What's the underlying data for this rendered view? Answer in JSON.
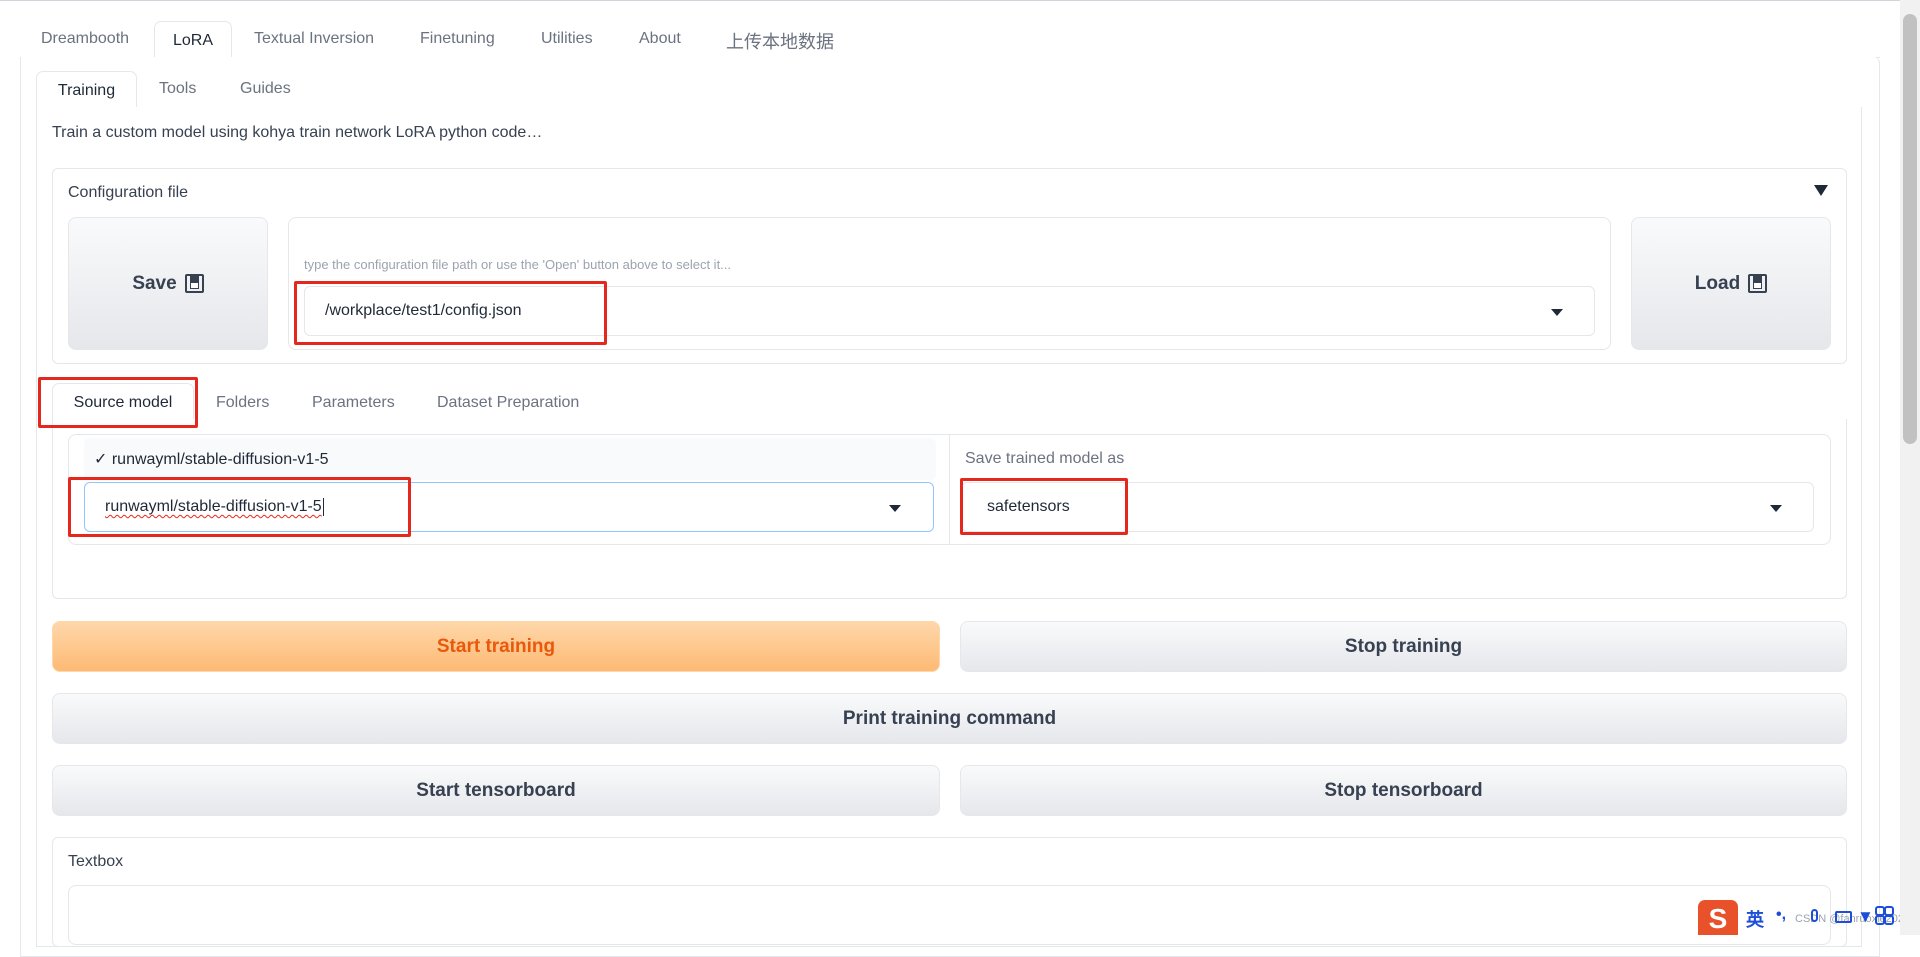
{
  "main_tabs": [
    "Dreambooth",
    "LoRA",
    "Textual Inversion",
    "Finetuning",
    "Utilities",
    "About",
    "上传本地数据"
  ],
  "sub_tabs": [
    "Training",
    "Tools",
    "Guides"
  ],
  "description": "Train a custom model using kohya train network LoRA python code…",
  "config": {
    "title": "Configuration file",
    "save_label": "Save",
    "load_label": "Load",
    "path_hint": "type the configuration file path or use the 'Open' button above to select it...",
    "path_value": "/workplace/test1/config.json"
  },
  "model_tabs": [
    "Source model",
    "Folders",
    "Parameters",
    "Dataset Preparation"
  ],
  "source_model": {
    "dropdown_option": "✓ runwayml/stable-diffusion-v1-5",
    "value": "runwayml/stable-diffusion-v1-5",
    "save_as_label": "Save trained model as",
    "save_as_value": "safetensors"
  },
  "buttons": {
    "start_training": "Start training",
    "stop_training": "Stop training",
    "print_command": "Print training command",
    "start_tensorboard": "Start tensorboard",
    "stop_tensorboard": "Stop tensorboard"
  },
  "textbox_label": "Textbox",
  "ime": {
    "lang": "英",
    "punct": "•,",
    "watermark": "CSDN @fanruoxie2023"
  },
  "colors": {
    "accent": "#ea580c",
    "highlight_box": "#e5281e"
  }
}
